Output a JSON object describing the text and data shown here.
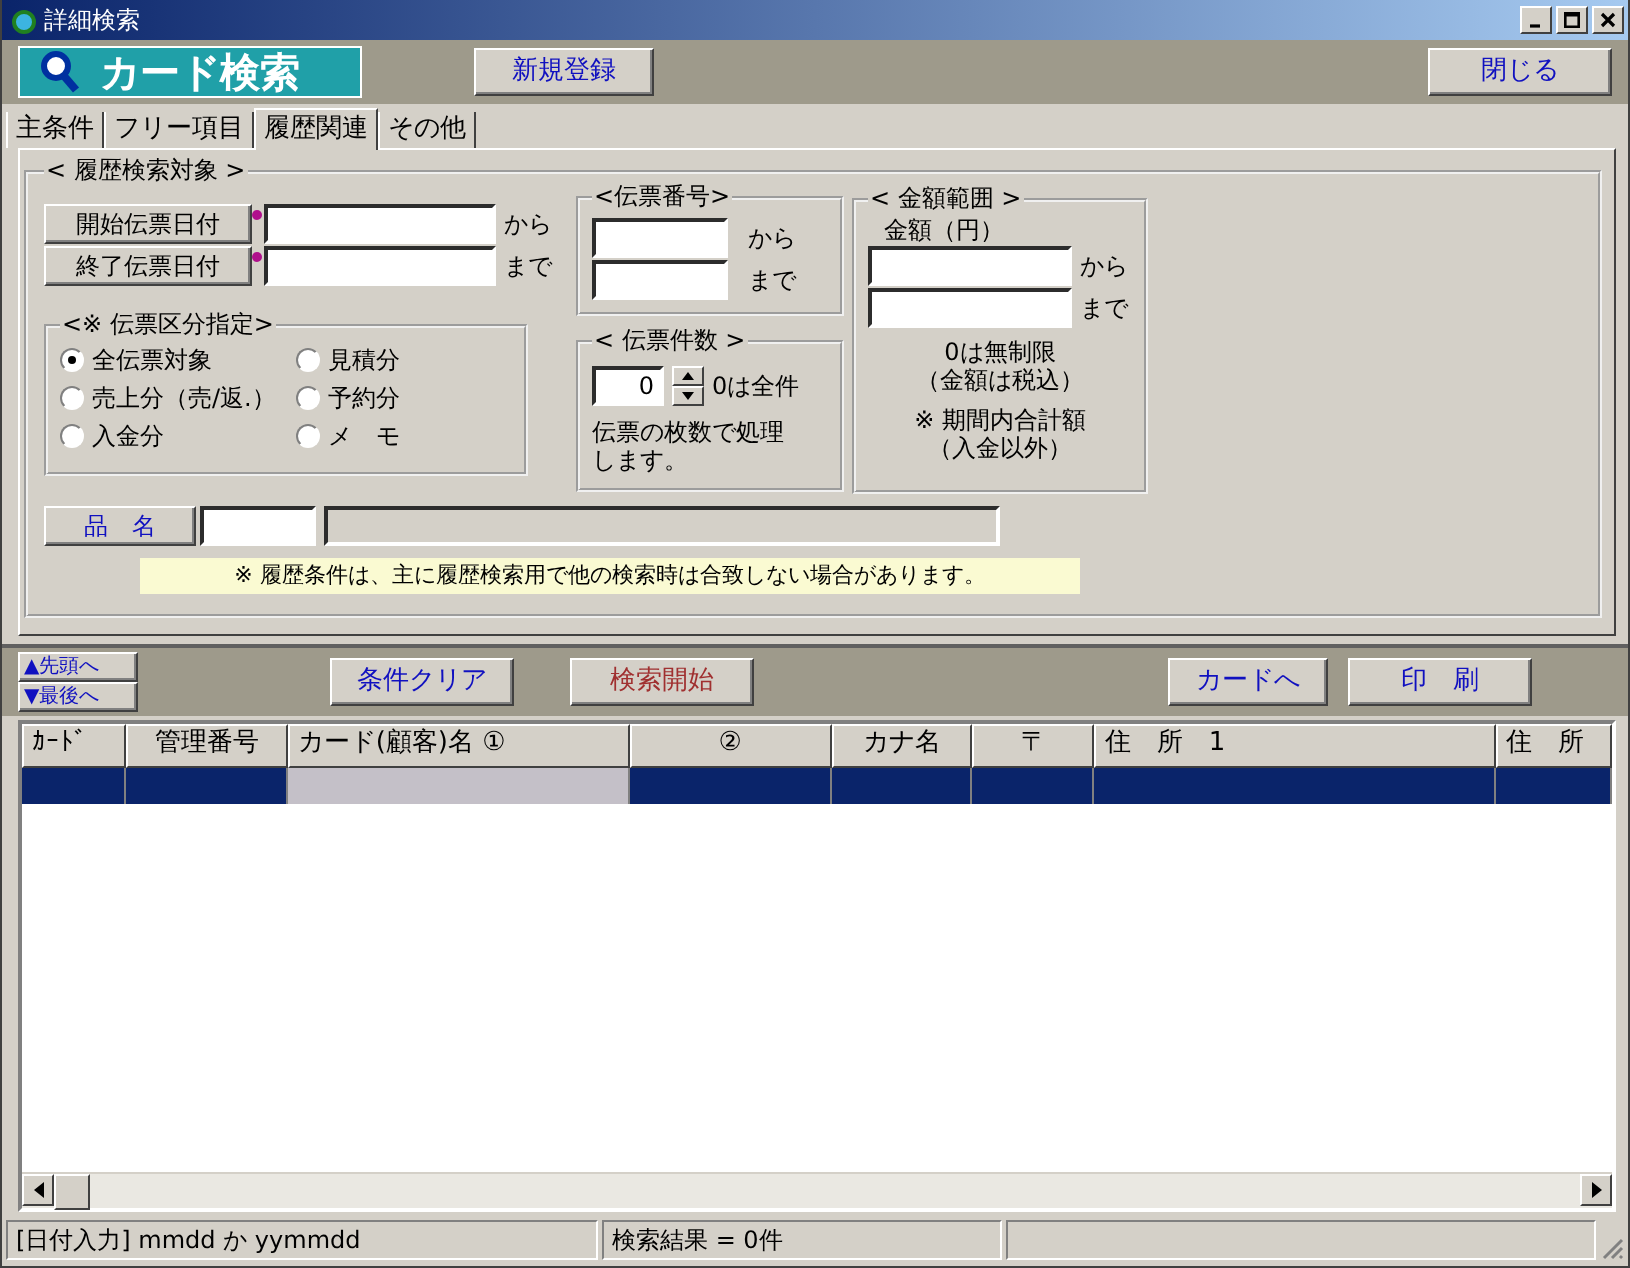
{
  "window": {
    "title": "詳細検索"
  },
  "header": {
    "logo": "カード検索",
    "buttons": [
      "新規登録",
      "閉じる"
    ]
  },
  "tabs": [
    {
      "label": "主条件",
      "selected": false
    },
    {
      "label": "フリー項目",
      "selected": false
    },
    {
      "label": "履歴関連",
      "selected": true
    },
    {
      "label": "その他",
      "selected": false
    }
  ],
  "history_search": {
    "title": "< 履歴検索対象 >",
    "date_fields": [
      {
        "label": "開始伝票日付",
        "suffix": "から"
      },
      {
        "label": "終了伝票日付",
        "suffix": "まで"
      }
    ],
    "slip_number": {
      "title": "<伝票番号>",
      "suffixes": [
        "から",
        "まで"
      ]
    },
    "amount_range": {
      "title": "< 金額範囲 >",
      "label": "金額（円）",
      "suffixes": [
        "から",
        "まで"
      ],
      "notes": [
        "0は無制限",
        "（金額は税込）"
      ],
      "totals": [
        "※  期間内合計額",
        "（入金以外）"
      ]
    },
    "slip_type": {
      "title": "<※ 伝票区分指定>",
      "options": [
        {
          "label": "全伝票対象",
          "selected": true
        },
        {
          "label": "見積分",
          "selected": false
        },
        {
          "label": "売上分（売/返.）",
          "selected": false
        },
        {
          "label": "予約分",
          "selected": false
        },
        {
          "label": "入金分",
          "selected": false
        },
        {
          "label": "メ　モ",
          "selected": false
        }
      ]
    },
    "slip_count": {
      "title": "< 伝票件数 >",
      "value": "0",
      "hint": "0は全件",
      "description": "伝票の枚数で処理します。"
    },
    "item_name": {
      "label": "品　名"
    },
    "note": "※ 履歴条件は、主に履歴検索用で他の検索時は合致しない場合があります。"
  },
  "actions": {
    "nav": [
      "▲先頭へ",
      "▼最後へ"
    ],
    "left_buttons": [
      {
        "label": "条件クリア",
        "kind": "normal"
      },
      {
        "label": "検索開始",
        "kind": "warning"
      }
    ],
    "right_buttons": [
      {
        "label": "カードへ",
        "kind": "normal"
      },
      {
        "label": "印　刷",
        "kind": "normal"
      }
    ]
  },
  "table": {
    "columns": [
      "ｶｰﾄﾞ",
      "管理番号",
      "カード(顧客)名 ①",
      "②",
      "カナ名",
      "〒",
      "住　所　1",
      "住　所"
    ],
    "rows": [
      {
        "selected": true
      }
    ]
  },
  "status_bar": [
    "[日付入力] mmdd か yymmdd",
    "検索結果 = 0件"
  ]
}
